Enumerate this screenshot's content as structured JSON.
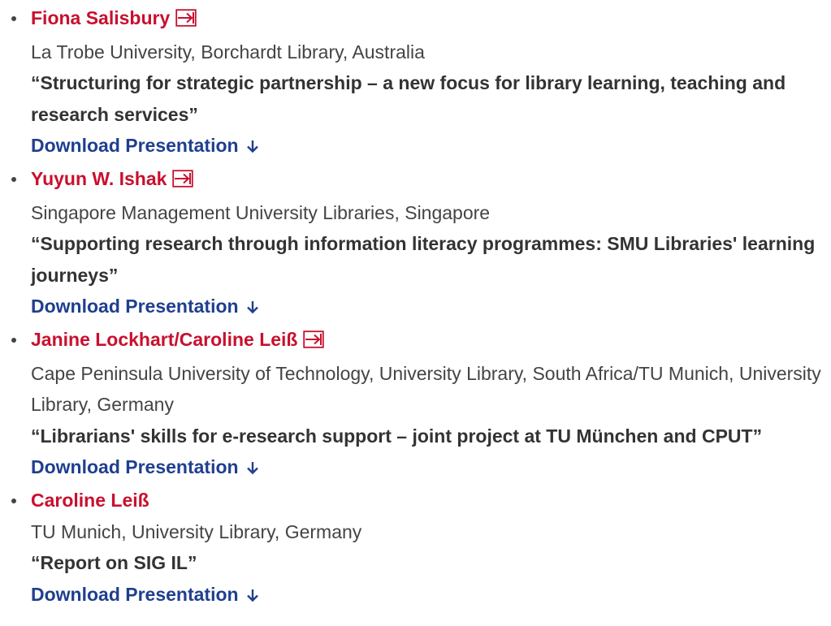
{
  "colors": {
    "name_red": "#c8102e",
    "link_blue": "#1f3f8f",
    "text_gray": "#444444",
    "title_dark": "#333333"
  },
  "icons": {
    "profile_link": "external-link-icon",
    "download": "arrow-down-icon"
  },
  "speakers": [
    {
      "name": "Fiona Salisbury",
      "has_profile_link": true,
      "affiliation": "La Trobe University, Borchardt Library, Australia",
      "title": "“Structuring for strategic partnership – a new focus for library learning, teaching and research services”",
      "download_label": "Download Presentation"
    },
    {
      "name": "Yuyun W. Ishak",
      "has_profile_link": true,
      "affiliation": "Singapore Management University Libraries, Singapore",
      "title": "“Supporting research through information literacy programmes: SMU Libraries' learning journeys”",
      "download_label": "Download Presentation"
    },
    {
      "name": "Janine Lockhart/Caroline Leiß",
      "has_profile_link": true,
      "affiliation": "Cape Peninsula University of Technology, University Library, South Africa/TU Munich, University Library, Germany",
      "title": "“Librarians' skills for e-research support – joint project at TU München and CPUT”",
      "download_label": "Download Presentation"
    },
    {
      "name": "Caroline Leiß",
      "has_profile_link": false,
      "affiliation": "TU Munich, University Library, Germany",
      "title": "“Report on SIG IL”",
      "download_label": "Download Presentation"
    }
  ]
}
